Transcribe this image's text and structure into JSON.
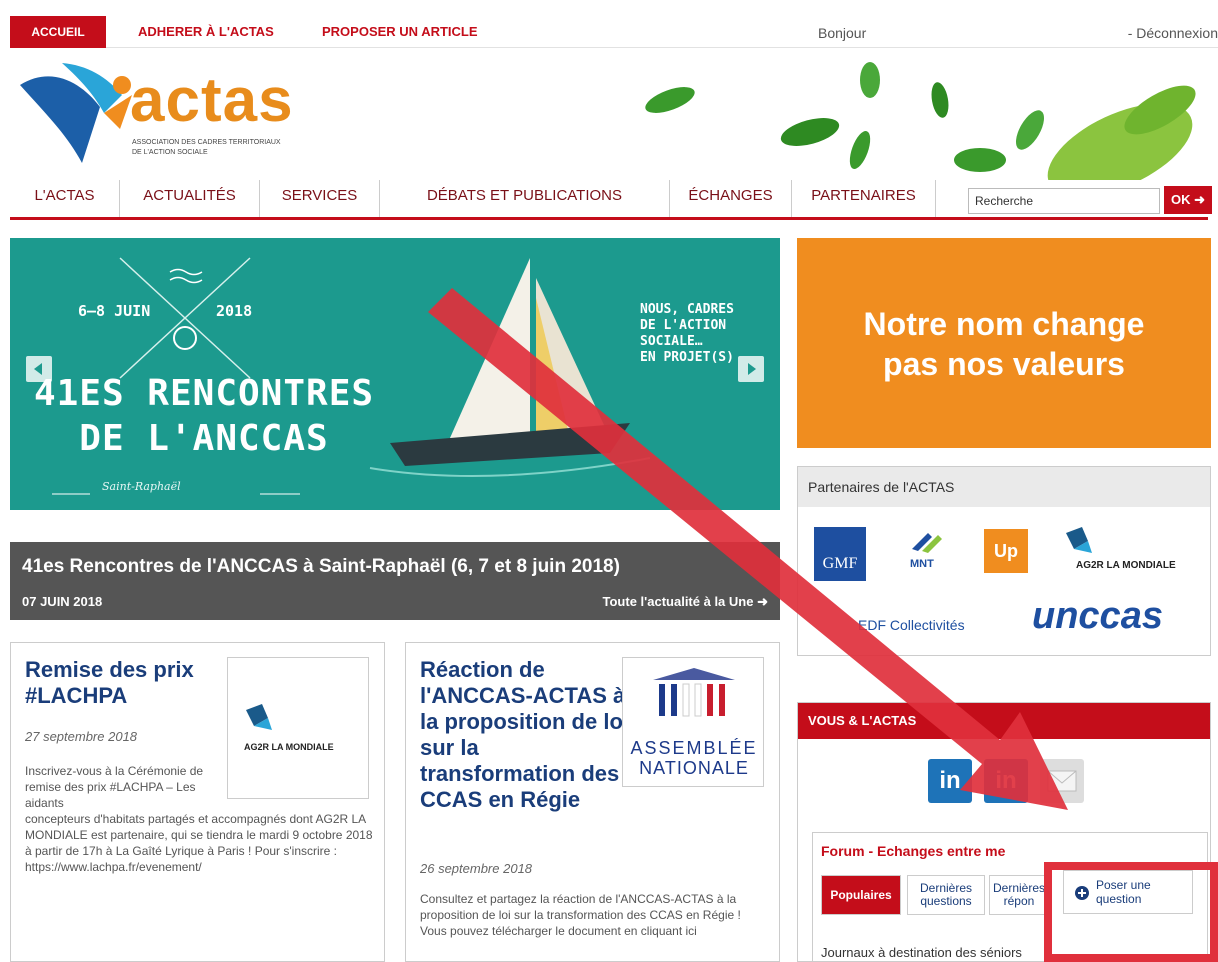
{
  "topbar": {
    "home": "ACCUEIL",
    "join": "ADHERER À L'ACTAS",
    "propose": "PROPOSER UN ARTICLE",
    "hello": "Bonjour",
    "logout": "- Déconnexion"
  },
  "logo": {
    "name": "actas",
    "subtitle_1": "ASSOCIATION DES CADRES TERRITORIAUX",
    "subtitle_2": "DE L'ACTION SOCIALE"
  },
  "nav": {
    "items": [
      "L'ACTAS",
      "ACTUALITÉS",
      "SERVICES",
      "DÉBATS ET PUBLICATIONS",
      "ÉCHANGES",
      "PARTENAIRES"
    ],
    "search_value": "Recherche",
    "ok": "OK"
  },
  "hero": {
    "dates": "6–8 JUIN",
    "year": "2018",
    "headline_1": "41ES RENCONTRES",
    "headline_2": "DE L'ANCCAS",
    "place": "Saint-Raphaël",
    "right_text": "NOUS, CADRES\nDE L'ACTION\nSOCIALE…\nEN PROJET(S)"
  },
  "caption": {
    "title": "41es Rencontres de l'ANCCAS à Saint-Raphaël (6, 7 et 8 juin 2018)",
    "date": "07 JUIN 2018",
    "more": "Toute l'actualité à la Une"
  },
  "articles": [
    {
      "title": "Remise des prix #LACHPA",
      "date": "27 septembre 2018",
      "body_short": "Inscrivez-vous à la Cérémonie de remise des prix #LACHPA – Les aidants",
      "body_long": "concepteurs d'habitats partagés et accompagnés dont AG2R LA MONDIALE est partenaire, qui se tiendra le mardi 9 octobre 2018 à partir de 17h à La Gaîté Lyrique à Paris ! Pour s'inscrire : https://www.lachpa.fr/evenement/",
      "thumb": "AG2R LA MONDIALE"
    },
    {
      "title": "Réaction de l'ANCCAS-ACTAS à la proposition de loi sur la transformation des CCAS en Régie",
      "date": "26 septembre 2018",
      "body": "Consultez et partagez la réaction de l'ANCCAS-ACTAS à la proposition de loi sur la transformation des CCAS en Régie ! Vous pouvez télécharger le document en cliquant ici",
      "thumb_1": "ASSEMBLÉE",
      "thumb_2": "NATIONALE"
    }
  ],
  "promo": {
    "line_1": "Notre nom change",
    "line_2": "pas nos valeurs"
  },
  "partners": {
    "title": "Partenaires de l'ACTAS",
    "logos": [
      "GMF",
      "MNT",
      "Up",
      "AG2R LA MONDIALE",
      "EDF Collectivités",
      "unccas"
    ]
  },
  "vous": {
    "title": "VOUS & L'ACTAS",
    "social": [
      "in",
      "in"
    ]
  },
  "forum": {
    "title": "Forum - Echanges entre me",
    "tabs": [
      "Populaires",
      "Dernières questions",
      "Dernières répon"
    ],
    "ask": "Poser une question",
    "first_item": "Journaux à destination des séniors"
  },
  "colors": {
    "brand_red": "#c40d1a",
    "orange": "#f08d1f",
    "teal": "#1c9a8e",
    "navy": "#1a3d7a",
    "annotation_red": "#e0303c"
  }
}
